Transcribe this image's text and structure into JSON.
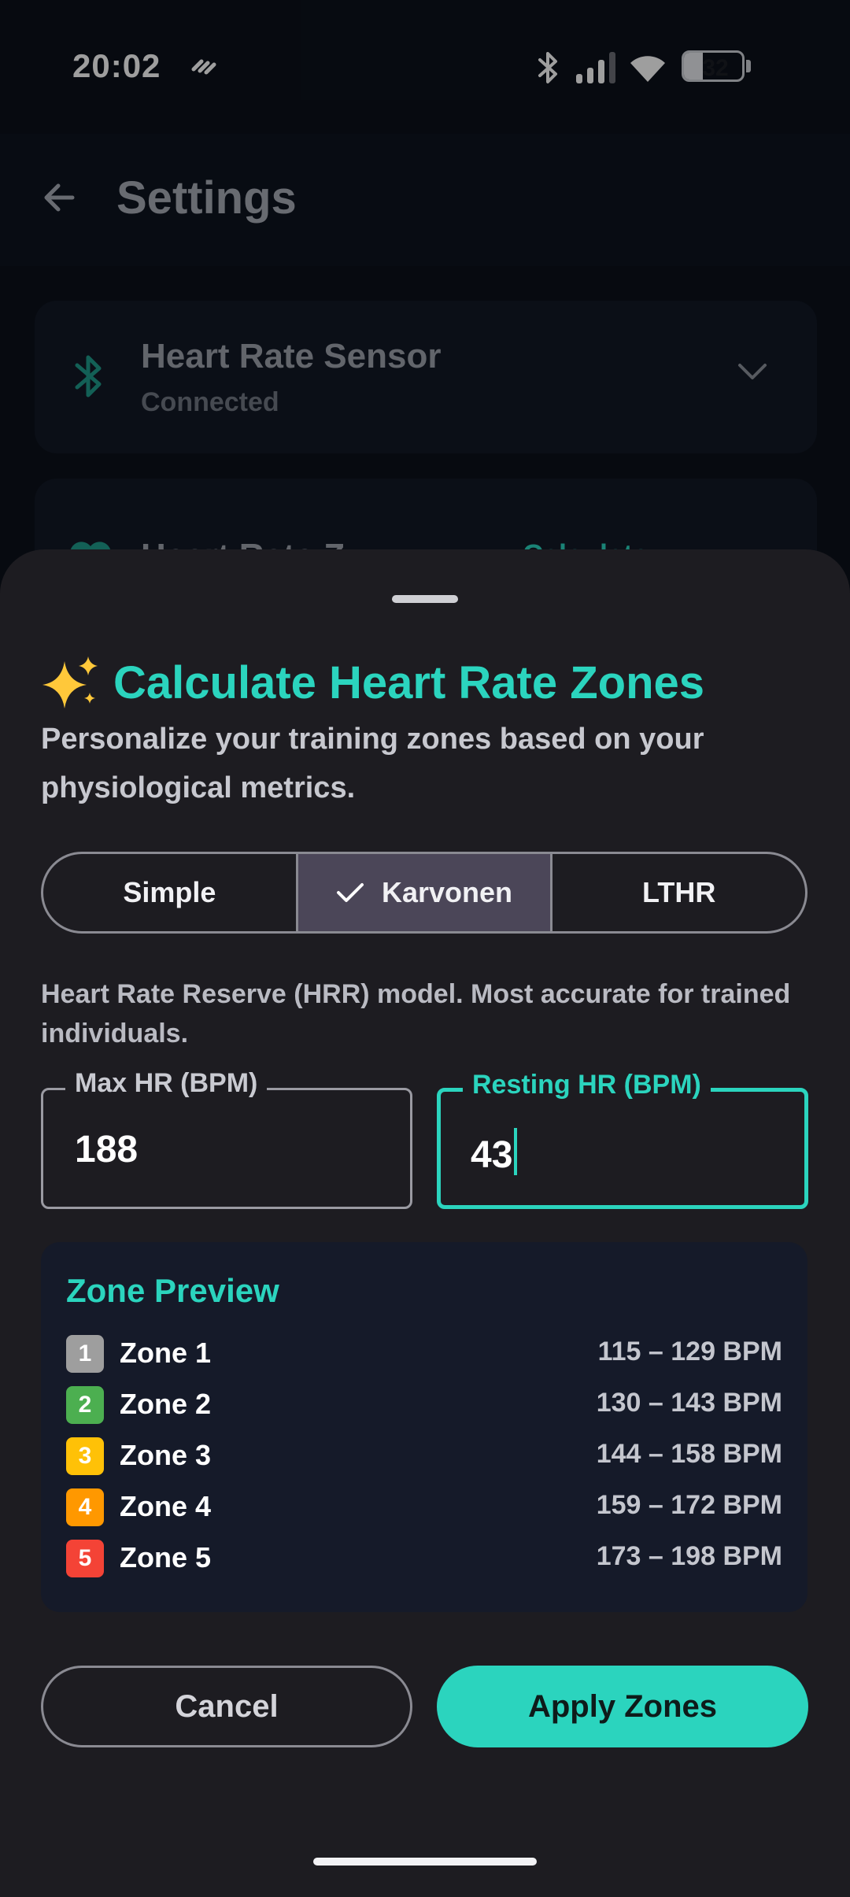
{
  "status_bar": {
    "time": "20:02",
    "battery": "32"
  },
  "app_bar": {
    "title": "Settings"
  },
  "settings": {
    "sensor_card": {
      "title": "Heart Rate Sensor",
      "status": "Connected"
    },
    "zones_card": {
      "title_partial": "Heart Rate Z",
      "link_partial": "Calculate"
    }
  },
  "sheet": {
    "title": "Calculate Heart Rate Zones",
    "description": "Personalize your training zones based on your physiological metrics.",
    "methods": [
      {
        "label": "Simple",
        "selected": false
      },
      {
        "label": "Karvonen",
        "selected": true
      },
      {
        "label": "LTHR",
        "selected": false
      }
    ],
    "model_description": "Heart Rate Reserve (HRR) model. Most accurate for trained individuals.",
    "max_hr": {
      "label": "Max HR (BPM)",
      "value": "188"
    },
    "resting_hr": {
      "label": "Resting HR (BPM)",
      "value": "43"
    },
    "zone_preview": {
      "title": "Zone Preview",
      "zones": [
        {
          "number": "1",
          "name": "Zone 1",
          "range": "115 – 129 BPM",
          "color": "#9e9e9e"
        },
        {
          "number": "2",
          "name": "Zone 2",
          "range": "130 – 143 BPM",
          "color": "#4caf50"
        },
        {
          "number": "3",
          "name": "Zone 3",
          "range": "144 – 158 BPM",
          "color": "#ffc107"
        },
        {
          "number": "4",
          "name": "Zone 4",
          "range": "159 – 172 BPM",
          "color": "#ff9800"
        },
        {
          "number": "5",
          "name": "Zone 5",
          "range": "173 – 198 BPM",
          "color": "#f44336"
        }
      ]
    },
    "cancel_label": "Cancel",
    "apply_label": "Apply Zones"
  },
  "colors": {
    "accent": "#2bd4be",
    "sheet_bg": "#1d1c21",
    "selected_segment": "#4b4658"
  }
}
